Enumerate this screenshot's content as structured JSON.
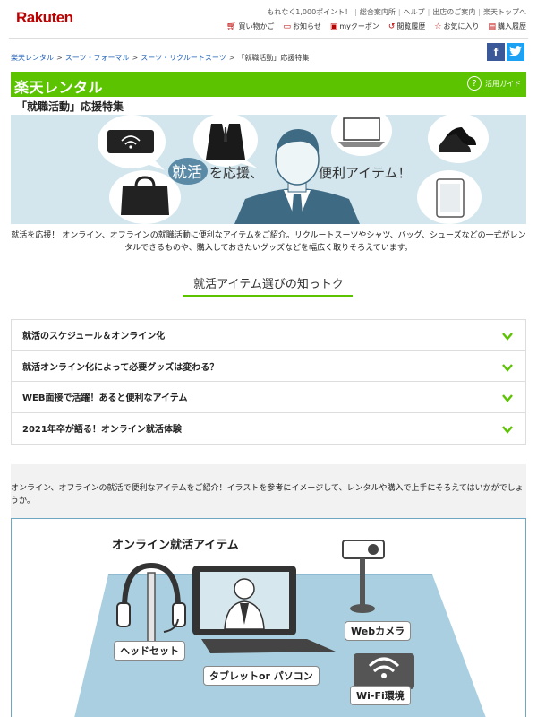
{
  "header": {
    "logo": "Rakuten",
    "top_links": [
      "もれなく1,000ポイント！",
      "総合案内所",
      "ヘルプ",
      "出店のご案内",
      "楽天トップへ"
    ],
    "utility": [
      {
        "icon": "cart-icon",
        "label": "買い物かご"
      },
      {
        "icon": "notification-icon",
        "label": "お知らせ"
      },
      {
        "icon": "coupon-icon",
        "label": "myクーポン"
      },
      {
        "icon": "history-icon",
        "label": "閲覧履歴"
      },
      {
        "icon": "star-icon",
        "label": "お気に入り"
      },
      {
        "icon": "purchase-history-icon",
        "label": "購入履歴"
      }
    ]
  },
  "breadcrumb": {
    "items": [
      "楽天レンタル",
      "スーツ・フォーマル",
      "スーツ・リクルートスーツ"
    ],
    "current": "「就職活動」応援特集"
  },
  "social": {
    "facebook": "f",
    "twitter": "t"
  },
  "green_bar": {
    "brand": "楽天レンタル",
    "guide_label": "活用ガイド",
    "color": "#5cc300"
  },
  "page_title": "「就職活動」応援特集",
  "hero": {
    "highlight": "就活",
    "text_mid": "を応援、",
    "text_right": "便利アイテム！"
  },
  "intro": "就活を応援！ オンライン、オフラインの就職活動に便利なアイテムをご紹介。リクルートスーツやシャツ、バッグ、シューズなどの一式がレンタルできるものや、購入しておきたいグッズなどを幅広く取りそろえています。",
  "section_title": "就活アイテム選びの知っトク",
  "accordion": [
    "就活のスケジュール＆オンライン化",
    "就活オンライン化によって必要グッズは変わる？",
    "WEB面接で活躍！あると便利なアイテム",
    "2021年卒が語る！オンライン就活体験"
  ],
  "gray_text": "オンライン、オフラインの就活で便利なアイテムをご紹介！イラストを参考にイメージして、レンタルや購入で上手にそろえてはいかがでしょうか。",
  "illustration": {
    "title": "オンライン就活アイテム",
    "labels": [
      "ヘッドセット",
      "タブレットor パソコン",
      "Webカメラ",
      "Wi-Fi環境"
    ]
  }
}
